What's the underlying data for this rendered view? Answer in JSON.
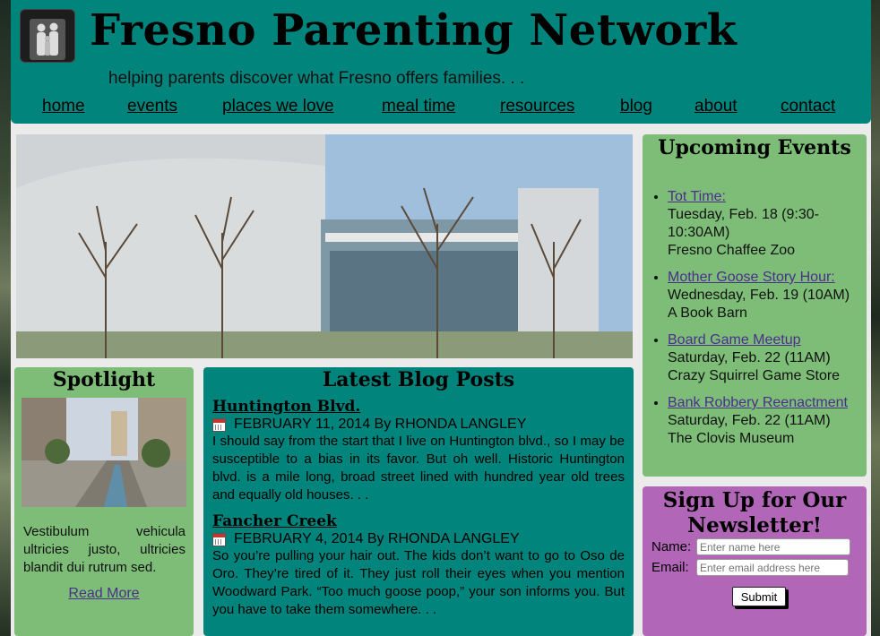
{
  "header": {
    "title": "Fresno Parenting Network",
    "tagline": "helping parents discover what Fresno offers families. . ."
  },
  "nav": {
    "items": [
      "home",
      "events",
      "places we love",
      "meal time",
      "resources",
      "blog",
      "about",
      "contact"
    ]
  },
  "events": {
    "heading": "Upcoming Events",
    "items": [
      {
        "name": "Tot Time:",
        "when": "Tuesday, Feb. 18 (9:30-10:30AM)",
        "where": "Fresno Chaffee Zoo"
      },
      {
        "name": "Mother Goose Story Hour:",
        "when": "Wednesday, Feb. 19 (10AM)",
        "where": "A Book Barn"
      },
      {
        "name": "Board Game Meetup",
        "when": "Saturday, Feb. 22 (11AM)",
        "where": "Crazy Squirrel Game Store"
      },
      {
        "name": "Bank Robbery Reenactment",
        "when": "Saturday, Feb. 22 (11AM)",
        "where": "The Clovis Museum"
      }
    ]
  },
  "spotlight": {
    "heading": "Spotlight",
    "text": "Vestibulum vehicula ultricies justo, ultricies blandit dui rutrum sed.",
    "link": "Read More"
  },
  "blog": {
    "heading": "Latest Blog Posts",
    "posts": [
      {
        "title": "Huntington Blvd.",
        "meta": "FEBRUARY 11, 2014 By RHONDA LANGLEY",
        "excerpt": "I should say from the start that I live on Huntington blvd., so I may be susceptible to a bias in its favor. But oh well. Historic Huntington blvd. is a mile long, broad street lined with hundred year old trees and equally old houses. . ."
      },
      {
        "title": "Fancher Creek",
        "meta": "FEBRUARY 4, 2014 By RHONDA LANGLEY",
        "excerpt": "So you’re pulling your hair out. The kids don’t want to go to Oso de Oro. They’re tired of it. They just roll their eyes when you mention Woodward Park. “Too much goose poop,” your son informs you. But you have to take them somewhere. . ."
      }
    ]
  },
  "newsletter": {
    "heading": "Sign Up for Our Newsletter!",
    "name_label": "Name:",
    "name_placeholder": "Enter name here",
    "email_label": "Email:",
    "email_placeholder": "Enter email address here",
    "submit_label": "Submit"
  },
  "colors": {
    "teal": "#00847c",
    "green": "#7dbd77",
    "purple": "#b266b7",
    "link": "#4b2f8c"
  },
  "icons": [
    "family-logo-icon",
    "calendar-icon"
  ]
}
